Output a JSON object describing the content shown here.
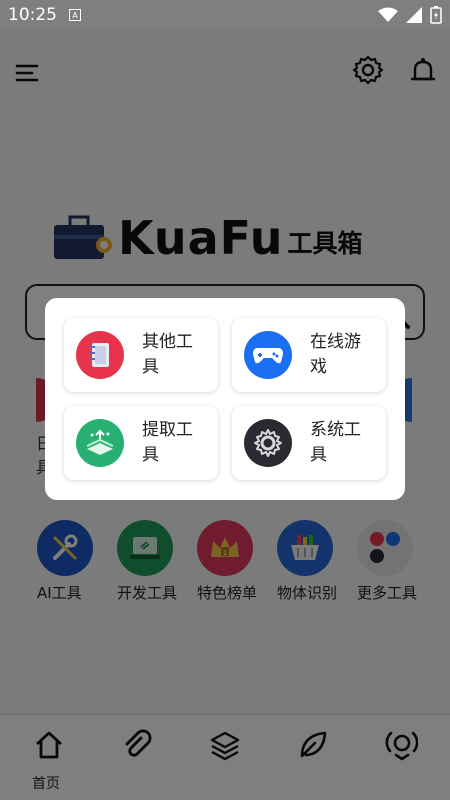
{
  "status": {
    "time": "10:25",
    "notification_badge": "A"
  },
  "header": {
    "brand": "KuaFu",
    "brand_sub": "工具箱"
  },
  "bg_peek_left_label": "日具",
  "tools": [
    {
      "label": "AI工具",
      "color": "#1f57c6",
      "icon": "wrench-screwdriver-icon"
    },
    {
      "label": "开发工具",
      "color": "#1e9a58",
      "icon": "laptop-icon"
    },
    {
      "label": "特色榜单",
      "color": "#e0365e",
      "icon": "crown-icon"
    },
    {
      "label": "物体识别",
      "color": "#2867d8",
      "icon": "basket-icon"
    },
    {
      "label": "更多工具",
      "color": "#e6e6e6",
      "icon": "more-apps-icon"
    }
  ],
  "dialog": {
    "items": [
      {
        "label": "其他工具",
        "color": "#e8334d",
        "icon": "notebook-icon"
      },
      {
        "label": "在线游戏",
        "color": "#1a6ff0",
        "icon": "gamepad-icon"
      },
      {
        "label": "提取工具",
        "color": "#27b072",
        "icon": "extract-icon"
      },
      {
        "label": "系统工具",
        "color": "#2a2a33",
        "icon": "gear-icon"
      }
    ]
  },
  "bottom_nav": [
    {
      "label": "首页",
      "icon": "home-icon"
    },
    {
      "label": "",
      "icon": "paperclip-icon"
    },
    {
      "label": "",
      "icon": "layers-icon"
    },
    {
      "label": "",
      "icon": "leaf-icon"
    },
    {
      "label": "",
      "icon": "tools-icon"
    }
  ]
}
